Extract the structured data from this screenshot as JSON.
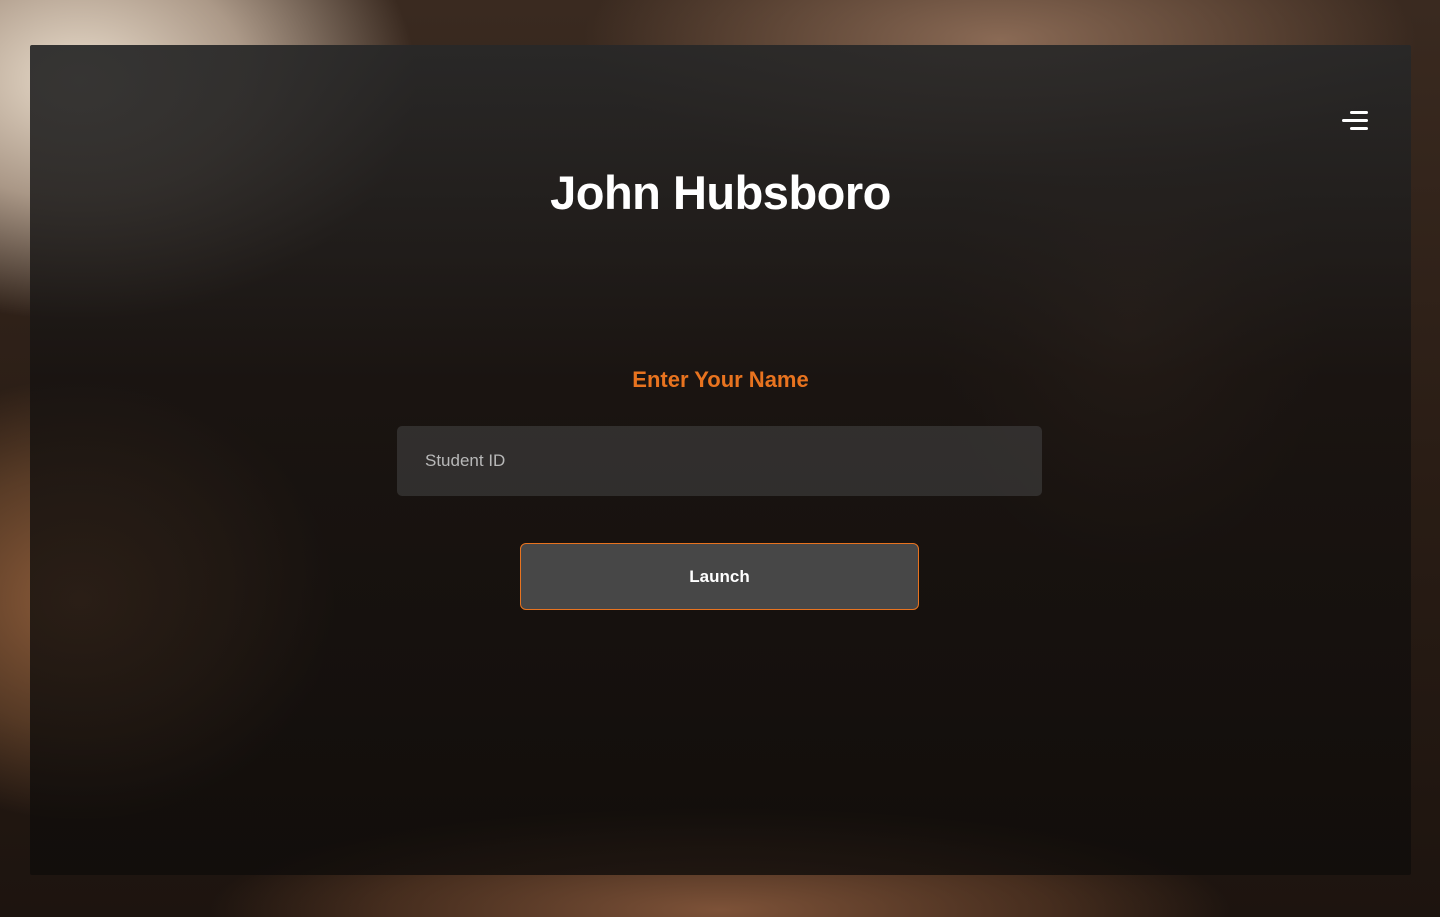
{
  "header": {
    "title": "John Hubsboro",
    "menu_icon": "hamburger-menu-icon"
  },
  "form": {
    "prompt": "Enter Your Name",
    "student_id_placeholder": "Student ID",
    "student_id_value": "",
    "launch_label": "Launch"
  },
  "colors": {
    "accent": "#e8731f",
    "panel": "#1e1a18",
    "button_bg": "#474747",
    "text": "#ffffff"
  }
}
